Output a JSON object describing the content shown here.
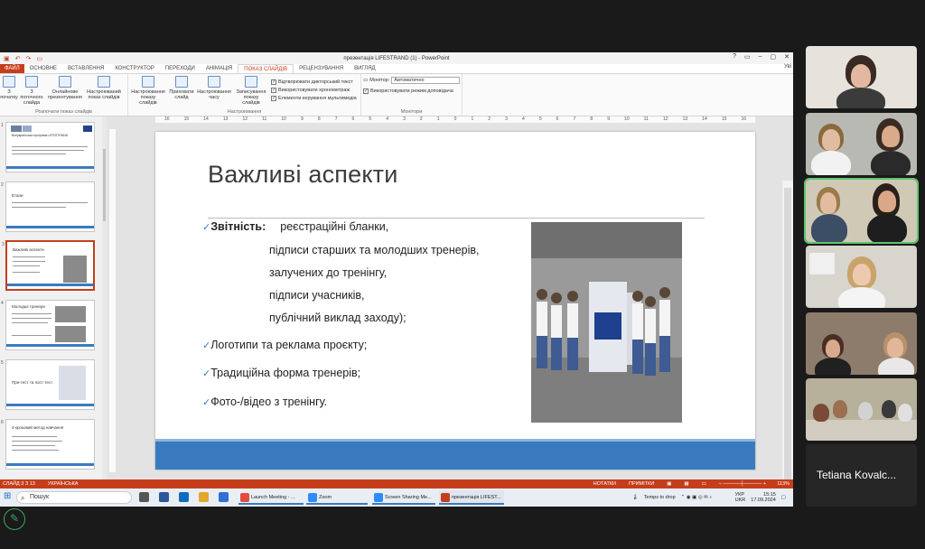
{
  "powerpoint": {
    "window_title": "презентація LIFESTRAND (1) - PowerPoint",
    "window_controls": [
      "?",
      "▭",
      "–",
      "▢",
      "✕"
    ],
    "tabs": [
      "ФАЙЛ",
      "ОСНОВНЕ",
      "ВСТАВЛЕННЯ",
      "КОНСТРУКТОР",
      "ПЕРЕХОДИ",
      "АНІМАЦІЯ",
      "ПОКАЗ СЛАЙДІВ",
      "РЕЦЕНЗУВАННЯ",
      "ВИГЛЯД"
    ],
    "user_label": "Уві",
    "ribbon": {
      "group_start_label": "Розпочати показ слайдів",
      "group_setup_label": "Настроювання",
      "group_monitors_label": "Монітори",
      "btn_from_start": "З початку",
      "btn_from_current": "З поточного слайда",
      "btn_online": "Онлайнове презентування",
      "btn_custom": "Настроюваний показ слайдів",
      "btn_setup": "Настроювання показу слайдів",
      "btn_hide": "Приховати слайд",
      "btn_rehearse": "Настроювання часу",
      "btn_record": "Записування показу слайдів",
      "chk_narrations": "Відтворювати дикторський текст",
      "chk_timings": "Використовувати хронометраж",
      "chk_media": "Елементи керування мультимедіа",
      "monitor_label": "Монітор:",
      "monitor_value": "Автоматично",
      "chk_presenter": "Використовувати режим доповідача"
    },
    "thumbnails": [
      {
        "num": "1",
        "title": "Всеукраїнська програма LIFESTRAND"
      },
      {
        "num": "2",
        "title": "Етапи"
      },
      {
        "num": "3",
        "title": "Важливі аспекти"
      },
      {
        "num": "4",
        "title": "Молодші тренери"
      },
      {
        "num": "5",
        "title": "Пре-тест та пост-тест"
      },
      {
        "num": "6",
        "title": "4-кроковий метод навчання"
      }
    ],
    "ruler_ticks": [
      "16",
      "15",
      "14",
      "13",
      "12",
      "11",
      "10",
      "9",
      "8",
      "7",
      "6",
      "5",
      "4",
      "3",
      "2",
      "1",
      "0",
      "1",
      "2",
      "3",
      "4",
      "5",
      "6",
      "7",
      "8",
      "9",
      "10",
      "11",
      "12",
      "13",
      "14",
      "15",
      "16"
    ],
    "slide": {
      "title": "Важливі аспекти",
      "bullet_mark": "✓",
      "bullet1_bold": "Звітність:",
      "bullet1_rest": "реєстраційні бланки,",
      "sub_lines": [
        "підписи старших та молодших тренерів,",
        "залучених до тренінгу,",
        "підписи учасників,",
        "публічний виклад заходу);"
      ],
      "bullet2": "Логотипи та реклама проєкту;",
      "bullet3": "Традиційна форма тренерів;",
      "bullet4": "Фото-/відео з тренінгу."
    },
    "status": {
      "slide_info": "СЛАЙД 3 З 13",
      "language": "УКРАЇНСЬКА",
      "notes": "НОТАТКИ",
      "comments": "ПРИМІТКИ",
      "zoom": "113%"
    }
  },
  "taskbar": {
    "search_placeholder": "Пошук",
    "apps": [
      "Launch Meeting - ...",
      "Zoom",
      "Screen Sharing Me...",
      "презентація LIFEST..."
    ],
    "weather": "Temps to drop",
    "lang1": "УКР",
    "lang2": "UKR",
    "time": "15:15",
    "date": "17.09.2024"
  },
  "zoom_gallery": {
    "name_tile": "Tetiana Kovalc..."
  },
  "colors": {
    "ppt_accent": "#c43e1c",
    "slide_blue": "#3a7bbf",
    "active_speaker": "#5dc46d"
  }
}
